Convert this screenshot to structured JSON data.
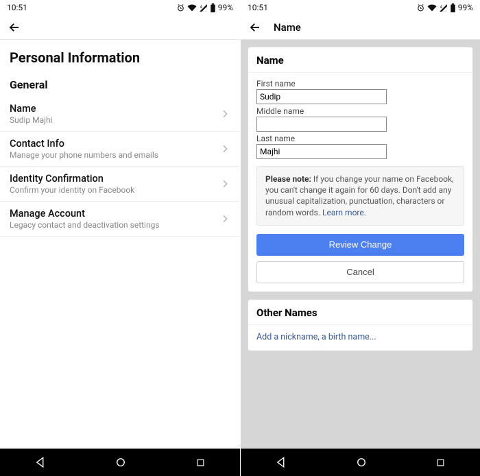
{
  "status": {
    "time": "10:51",
    "battery": "99%"
  },
  "left": {
    "page_title": "Personal Information",
    "section": "General",
    "items": [
      {
        "title": "Name",
        "sub": "Sudip Majhi"
      },
      {
        "title": "Contact Info",
        "sub": "Manage your phone numbers and emails"
      },
      {
        "title": "Identity Confirmation",
        "sub": "Confirm your identity on Facebook"
      },
      {
        "title": "Manage Account",
        "sub": "Legacy contact and deactivation settings"
      }
    ]
  },
  "right": {
    "header_title": "Name",
    "card_title": "Name",
    "fields": {
      "first_label": "First name",
      "first_value": "Sudip",
      "middle_label": "Middle name",
      "middle_value": "",
      "last_label": "Last name",
      "last_value": "Majhi"
    },
    "note_prefix": "Please note:",
    "note_body": " If you change your name on Facebook, you can't change it again for 60 days. Don't add any unusual capitalization, punctuation, characters or random words. ",
    "note_learn": "Learn more.",
    "review_btn": "Review Change",
    "cancel_btn": "Cancel",
    "other_title": "Other Names",
    "add_nick": "Add a nickname, a birth name..."
  }
}
